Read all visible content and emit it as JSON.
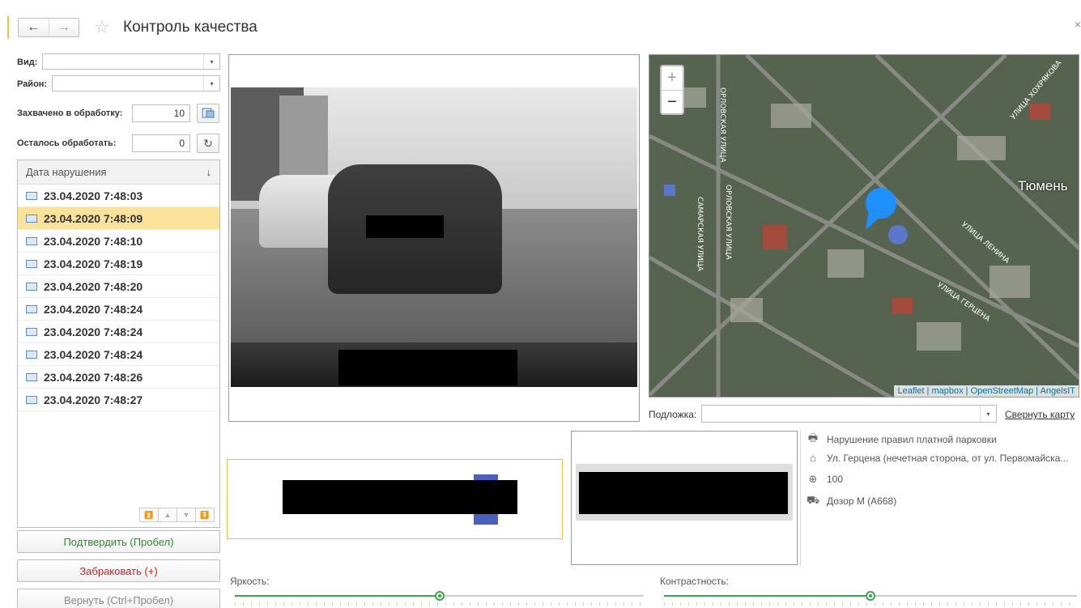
{
  "header": {
    "title": "Контроль качества",
    "back_label": "←",
    "forward_label": "→",
    "star": "☆",
    "close": "×"
  },
  "filters": {
    "vid_label": "Вид:",
    "vid_value": "",
    "raion_label": "Район:",
    "raion_value": "",
    "captured_label": "Захвачено в обработку:",
    "captured_value": "10",
    "remaining_label": "Осталось обработать:",
    "remaining_value": "0"
  },
  "list": {
    "header": "Дата нарушения",
    "sort_icon": "↓",
    "selected_index": 1,
    "items": [
      "23.04.2020 7:48:03",
      "23.04.2020 7:48:09",
      "23.04.2020 7:48:10",
      "23.04.2020 7:48:19",
      "23.04.2020 7:48:20",
      "23.04.2020 7:48:24",
      "23.04.2020 7:48:24",
      "23.04.2020 7:48:24",
      "23.04.2020 7:48:26",
      "23.04.2020 7:48:27"
    ]
  },
  "actions": {
    "confirm_label": "Подтвердить (Пробел)",
    "confirm_color": "#2e8b2e",
    "reject_label": "Забраковать (+)",
    "reject_color": "#cc2222",
    "return_label": "Вернуть (Ctrl+Пробел)",
    "return_color": "#888888"
  },
  "map": {
    "city_label": "Тюмень",
    "attribution": "Leaflet | mapbox | OpenStreetMap | AngelsIT",
    "streets": [
      "ОРЛОВСКАЯ УЛИЦА",
      "ОРЛОВСКАЯ УЛИЦА",
      "САМАРСКАЯ УЛИЦА",
      "УЛИЦА ХОХРЯКОВА",
      "УЛИЦА ЛЕНИНА",
      "УЛИЦА ГЕРЦЕНА"
    ],
    "zoom_in": "+",
    "zoom_out": "−",
    "pin_color": "#1e90ff"
  },
  "layer": {
    "label": "Подложка:",
    "value": "",
    "collapse_link": "Свернуть карту"
  },
  "info": {
    "violation": "Нарушение правил платной парковки",
    "address": "Ул. Герцена (нечетная сторона, от ул. Первомайска...",
    "speed": "100",
    "device": "Дозор М (А668)"
  },
  "sliders": {
    "brightness_label": "Яркость:",
    "brightness_value": 0.5,
    "contrast_label": "Контрастность:",
    "contrast_value": 0.5
  }
}
